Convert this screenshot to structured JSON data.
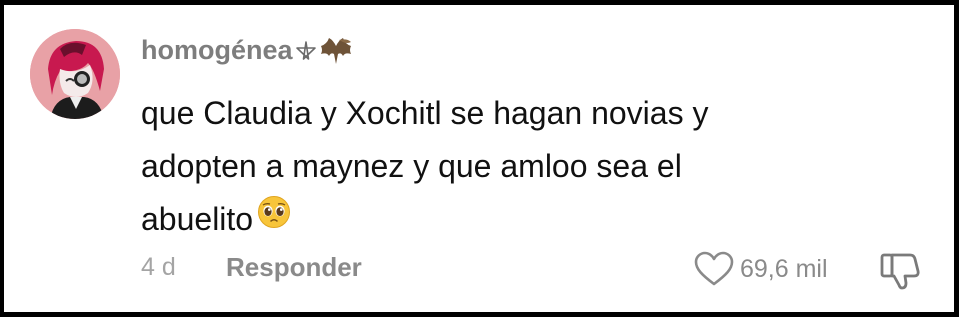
{
  "comment": {
    "username": "homogénea",
    "username_decoration_icons": [
      "pentagram-icon",
      "bat-icon"
    ],
    "text_lines": [
      "que Claudia y Xochitl se hagan novias y",
      "adopten a maynez y que amloo sea el",
      "abuelito"
    ],
    "text_emoji": "pleading-face-emoji",
    "timestamp": "4 d",
    "reply_label": "Responder",
    "like_icon": "heart-outline-icon",
    "like_count": "69,6 mil",
    "dislike_icon": "thumbs-down-outline-icon"
  },
  "colors": {
    "username": "#7d7d7d",
    "text": "#111111",
    "meta": "#a4a4a4",
    "action": "#8a8a8a",
    "avatar_bg": "#e8a1a6",
    "border": "#000000"
  }
}
